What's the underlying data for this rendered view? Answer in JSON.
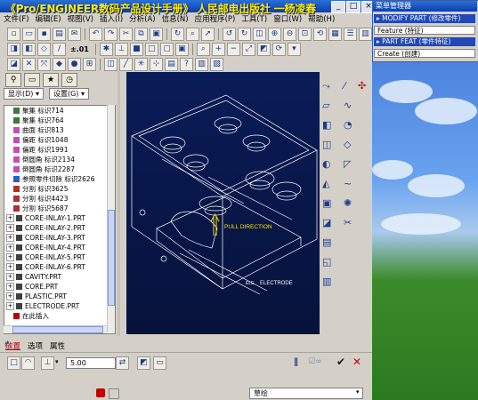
{
  "window": {
    "banner": "《Pro/ENGINEER数码产品设计手册》 人民邮电出版社 一杨凌春",
    "controls": [
      "minimize-label",
      "maximize-label",
      "close-label"
    ],
    "control_glyphs": [
      "_",
      "□",
      "×"
    ]
  },
  "menubar": [
    "文件(F)",
    "编辑(E)",
    "视图(V)",
    "插入(I)",
    "分析(A)",
    "信息(N)",
    "应用程序(P)",
    "工具(T)",
    "窗口(W)",
    "帮助(H)"
  ],
  "toolbar": {
    "zoom_value": "±.01"
  },
  "navigator": {
    "show_label": "显示(D) ▾",
    "settings_label": "设置(G) ▾",
    "tree": [
      {
        "label": "聚集 标识714",
        "kind": "feature",
        "expander": false
      },
      {
        "label": "聚集 标识764",
        "kind": "feature",
        "expander": false
      },
      {
        "label": "曲面 标识813",
        "kind": "surface",
        "expander": false
      },
      {
        "label": "偏距 标识1048",
        "kind": "surface",
        "expander": false
      },
      {
        "label": "偏距 标识1991",
        "kind": "surface",
        "expander": false
      },
      {
        "label": "倒圆角 标识2134",
        "kind": "surface",
        "expander": false
      },
      {
        "label": "倒圆角 标识2287",
        "kind": "surface",
        "expander": false
      },
      {
        "label": "参照零件切除 标识2626",
        "kind": "cut",
        "expander": false
      },
      {
        "label": "分割 标识3625",
        "kind": "split",
        "expander": false
      },
      {
        "label": "分割 标识4423",
        "kind": "split",
        "expander": false
      },
      {
        "label": "分割 标识5687",
        "kind": "split",
        "expander": false
      },
      {
        "label": "CORE-INLAY-1.PRT",
        "kind": "part",
        "expander": true
      },
      {
        "label": "CORE-INLAY-2.PRT",
        "kind": "part",
        "expander": true
      },
      {
        "label": "CORE-INLAY-3.PRT",
        "kind": "part",
        "expander": true
      },
      {
        "label": "CORE-INLAY-4.PRT",
        "kind": "part",
        "expander": true
      },
      {
        "label": "CORE-INLAY-5.PRT",
        "kind": "part",
        "expander": true
      },
      {
        "label": "CORE-INLAY-6.PRT",
        "kind": "part",
        "expander": true
      },
      {
        "label": "CAVITY.PRT",
        "kind": "part",
        "expander": true
      },
      {
        "label": "CORE.PRT",
        "kind": "part",
        "expander": true
      },
      {
        "label": "PLASTIC.PRT",
        "kind": "part",
        "expander": true
      },
      {
        "label": "ELECTRODE.PRT",
        "kind": "part",
        "expander": true
      },
      {
        "label": "在此插入",
        "kind": "insert",
        "expander": false
      }
    ]
  },
  "viewport": {
    "pull_direction_label": "PULL DIRECTION",
    "electrode_label": "ELECTRODE",
    "electrode_prefix": "ELE",
    "background_top": "#0a1c58",
    "line_color": "#ffffff"
  },
  "dashboard": {
    "tabs": [
      "放置",
      "选项",
      "属性"
    ],
    "value": "5.00",
    "active_tab_color": "#c00000"
  },
  "statusbar": {
    "filter_label": "草绘"
  },
  "menu_manager": {
    "title": "菜单管理器",
    "rows": [
      {
        "label": "▸ MODIFY PART (修改零件)",
        "selected": true
      },
      {
        "label": "Feature (特征)",
        "selected": false
      },
      {
        "label": "▸ PART FEAT (零件特征)",
        "selected": true
      },
      {
        "label": "Create (创建)",
        "selected": false
      }
    ]
  },
  "colors": {
    "accent": "#0a3fb0",
    "banner_text": "#ffeb00",
    "window_bg": "#d4d0c8"
  }
}
